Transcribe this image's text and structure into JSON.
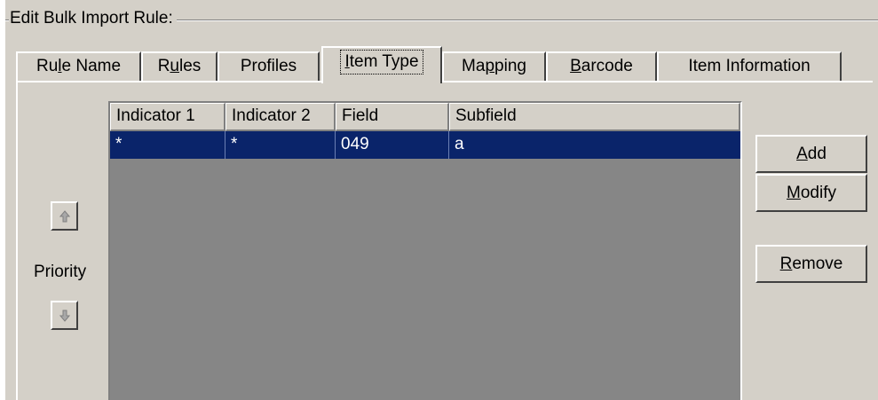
{
  "group": {
    "label": "Edit  Bulk Import Rule:"
  },
  "tabs": [
    {
      "label_pre": "Ru",
      "label_u": "l",
      "label_post": "e Name"
    },
    {
      "label_pre": "R",
      "label_u": "u",
      "label_post": "les"
    },
    {
      "label_pre": "Profiles",
      "label_u": "",
      "label_post": ""
    },
    {
      "label_pre": "",
      "label_u": "I",
      "label_post": "tem Type"
    },
    {
      "label_pre": "Ma",
      "label_u": "p",
      "label_post": "ping"
    },
    {
      "label_pre": "",
      "label_u": "B",
      "label_post": "arcode"
    },
    {
      "label_pre": "Item Information",
      "label_u": "",
      "label_post": ""
    }
  ],
  "table": {
    "columns": [
      "Indicator 1",
      "Indicator 2",
      "Field",
      "Subfield"
    ],
    "rows": [
      [
        "*",
        "*",
        "049",
        "a"
      ]
    ]
  },
  "buttons": {
    "add": {
      "u": "A",
      "rest": "dd"
    },
    "modify": {
      "u": "M",
      "rest": "odify"
    },
    "remove": {
      "u": "R",
      "rest": "emove"
    }
  },
  "priority": {
    "label": "Priority",
    "up_icon": "arrow-up-icon",
    "down_icon": "arrow-down-icon"
  }
}
